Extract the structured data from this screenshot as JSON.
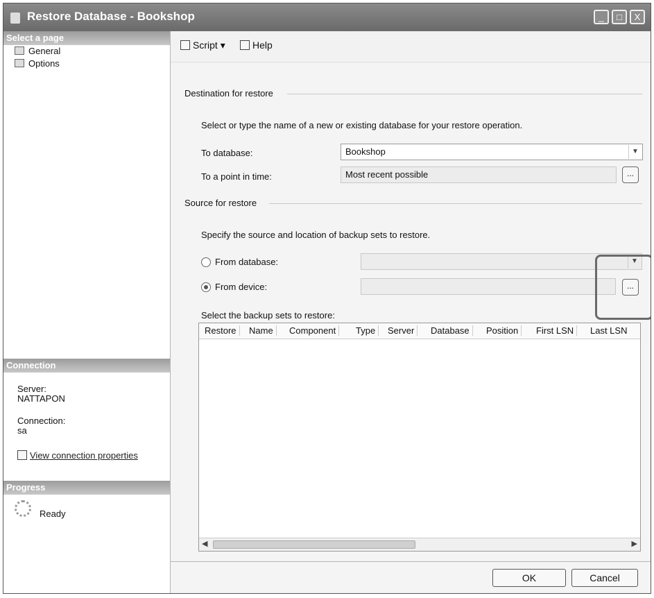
{
  "window": {
    "title": "Restore Database - Bookshop",
    "controls": [
      "_",
      "□",
      "X"
    ]
  },
  "sidebar": {
    "select_header": "Select a page",
    "pages": [
      {
        "label": "General",
        "icon": "page-icon"
      },
      {
        "label": "Options",
        "icon": "page-icon"
      }
    ],
    "connection_header": "Connection",
    "server_label": "Server:",
    "server_value": "NATTAPON",
    "connection_label": "Connection:",
    "connection_value": "sa",
    "view_connection_link": "View connection properties",
    "progress_header": "Progress",
    "progress_status": "Ready"
  },
  "toolbar": {
    "script_label": "Script",
    "help_label": "Help"
  },
  "destination": {
    "group_label": "Destination for restore",
    "instruction": "Select or type the name of a new or existing database for your restore operation.",
    "to_database_label": "To database:",
    "to_database_value": "Bookshop",
    "point_in_time_label": "To a point in time:",
    "point_in_time_value": "Most recent possible",
    "ellipsis": "..."
  },
  "source": {
    "group_label": "Source for restore",
    "instruction": "Specify the source and location of backup sets to restore.",
    "from_database_label": "From database:",
    "from_device_label": "From device:",
    "selected": "from_device",
    "ellipsis": "...",
    "backup_sets_label": "Select the backup sets to restore:",
    "columns": [
      "Restore",
      "Name",
      "Component",
      "Type",
      "Server",
      "Database",
      "Position",
      "First LSN",
      "Last LSN"
    ]
  },
  "footer": {
    "ok_label": "OK",
    "cancel_label": "Cancel"
  }
}
